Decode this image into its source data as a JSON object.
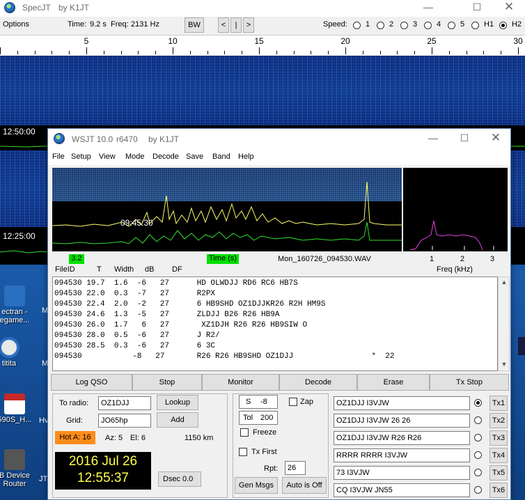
{
  "desktop": {
    "icons": [
      {
        "label": "ectran -\negame...",
        "color": "#2a6fc0"
      },
      {
        "label": "titita",
        "color": "#e0e0e0"
      },
      {
        "label": "590S_H...",
        "color": "#c62828"
      },
      {
        "label": "B Device\nRouter",
        "color": "#666"
      }
    ],
    "partial_labels": [
      "M",
      "M",
      "Hv",
      "JT"
    ]
  },
  "specjt": {
    "title": "SpecJT",
    "author": "by K1JT",
    "options_label": "Options",
    "time_label": "Time:",
    "time_value": "9.2 s",
    "freq_label": "Freq:",
    "freq_value": "2131 Hz",
    "bw_label": "BW",
    "nav_prev": "<",
    "nav_pause": "|",
    "nav_next": ">",
    "speed_label": "Speed:",
    "speed_options": [
      "1",
      "2",
      "3",
      "4",
      "5",
      "H1",
      "H2"
    ],
    "speed_selected": "H2",
    "ruler_labels": [
      "5",
      "10",
      "15",
      "20",
      "25",
      "30"
    ],
    "timestamps": [
      "12:50:00",
      "12:25:00"
    ]
  },
  "wsjt": {
    "title": "WSJT 10.0",
    "revision": "r6470",
    "author": "by K1JT",
    "menu": [
      "File",
      "Setup",
      "View",
      "Mode",
      "Decode",
      "Save",
      "Band",
      "Help"
    ],
    "graph_time": "09:45:30",
    "indicator_value": "3.2",
    "time_axis_label": "Time (s)",
    "wav_name": "Mon_160726_094530.WAV",
    "spectrum_ticks": [
      "1",
      "2",
      "3"
    ],
    "freq_axis_label": "Freq (kHz)",
    "columns": [
      "FileID",
      "T",
      "Width",
      "dB",
      "DF"
    ],
    "decodes": [
      "094530 19.7  1.6  -6   27      HD OLWDJJ RD6 RC6 HB7S",
      "094530 22.0  0.3  -7   27      R2PX",
      "094530 22.4  2.0  -2   27      6 HB9SHD OZ1DJJKR26 R2H HM9S",
      "094530 24.6  1.3  -5   27      ZLDJJ B26 R26 HB9A",
      "094530 26.0  1.7   6   27       XZ1DJH R26 R26 HB9SIW O",
      "094530 28.0  0.5  -6   27      J R2/",
      "094530 28.5  0.3  -6   27      6 3C",
      "094530           -8   27       R26 R26 HB9SHD OZ1DJJ                 *  22"
    ],
    "buttons": {
      "log_qso": "Log QSO",
      "stop": "Stop",
      "monitor": "Monitor",
      "decode": "Decode",
      "erase": "Erase",
      "tx_stop": "Tx Stop"
    },
    "to_radio_label": "To radio:",
    "to_radio_value": "OZ1DJJ",
    "lookup_label": "Lookup",
    "grid_label": "Grid:",
    "grid_value": "JO65hp",
    "add_label": "Add",
    "hot_a": "Hot A: 16",
    "az": "Az: 5",
    "el": "El: 6",
    "distance": "1150 km",
    "clock_date": "2016 Jul 26",
    "clock_time": "12:55:37",
    "dsec_label": "Dsec",
    "dsec_value": "0.0",
    "s_label": "S",
    "s_value": "-8",
    "tol_label": "Tol",
    "tol_value": "200",
    "zap_label": "Zap",
    "freeze_label": "Freeze",
    "tx_first_label": "Tx First",
    "rpt_label": "Rpt:",
    "rpt_value": "26",
    "gen_msgs": "Gen Msgs",
    "auto_off": "Auto is Off",
    "tx_messages": [
      "OZ1DJJ I3VJW",
      "OZ1DJJ I3VJW 26 26",
      "OZ1DJJ I3VJW R26 R26",
      "RRRR RRRR I3VJW",
      "73 I3VJW",
      "CQ I3VJW JN55"
    ],
    "tx_labels": [
      "Tx1",
      "Tx2",
      "Tx3",
      "Tx4",
      "Tx5",
      "Tx6"
    ],
    "tx_selected": 0,
    "colors": {
      "hot_bg": "#ff8c1a",
      "clock_fg": "#ffff4a",
      "trace_yellow": "#ffff6a",
      "trace_green": "#30e030",
      "spectrum_magenta": "#e040e0"
    }
  }
}
